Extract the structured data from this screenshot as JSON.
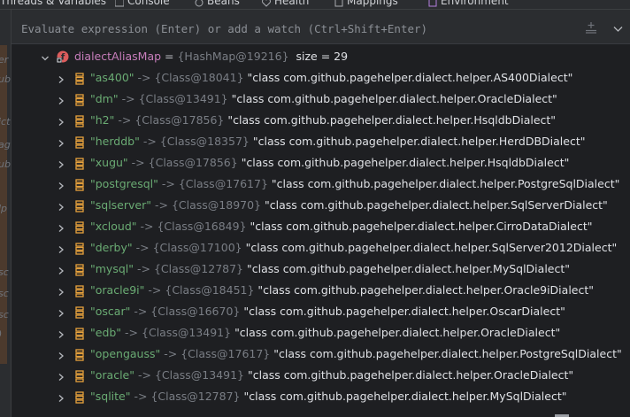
{
  "tabs": [
    {
      "label": "Threads & Variables"
    },
    {
      "label": "Console"
    },
    {
      "label": "Beans"
    },
    {
      "label": "Health"
    },
    {
      "label": "Mappings"
    },
    {
      "label": "Environment"
    }
  ],
  "left_gutter": {
    "fragments": [
      "er",
      "ub",
      "ict",
      "ag",
      "ub",
      "lp",
      "sc",
      "sc",
      "sc",
      ")"
    ]
  },
  "evaluate": {
    "placeholder": "Evaluate expression (Enter) or add a watch (Ctrl+Shift+Enter)"
  },
  "colors": {
    "key_green": "#6aab73",
    "root_name": "#c77dbb",
    "field_icon_orange": "#e8a33d",
    "root_icon_red": "#db5c5c"
  },
  "root": {
    "name": "dialectAliasMap",
    "equals": " = ",
    "ref": "{HashMap@19216}",
    "size": "size = 29",
    "expanded": true
  },
  "entries": [
    {
      "key": "\"as400\"",
      "arrow": "->",
      "ref": "{Class@18041}",
      "value": "\"class com.github.pagehelper.dialect.helper.AS400Dialect\""
    },
    {
      "key": "\"dm\"",
      "arrow": "->",
      "ref": "{Class@13491}",
      "value": "\"class com.github.pagehelper.dialect.helper.OracleDialect\""
    },
    {
      "key": "\"h2\"",
      "arrow": "->",
      "ref": "{Class@17856}",
      "value": "\"class com.github.pagehelper.dialect.helper.HsqldbDialect\""
    },
    {
      "key": "\"herddb\"",
      "arrow": "->",
      "ref": "{Class@18357}",
      "value": "\"class com.github.pagehelper.dialect.helper.HerdDBDialect\""
    },
    {
      "key": "\"xugu\"",
      "arrow": "->",
      "ref": "{Class@17856}",
      "value": "\"class com.github.pagehelper.dialect.helper.HsqldbDialect\""
    },
    {
      "key": "\"postgresql\"",
      "arrow": "->",
      "ref": "{Class@17617}",
      "value": "\"class com.github.pagehelper.dialect.helper.PostgreSqlDialect\""
    },
    {
      "key": "\"sqlserver\"",
      "arrow": "->",
      "ref": "{Class@18970}",
      "value": "\"class com.github.pagehelper.dialect.helper.SqlServerDialect\""
    },
    {
      "key": "\"xcloud\"",
      "arrow": "->",
      "ref": "{Class@16849}",
      "value": "\"class com.github.pagehelper.dialect.helper.CirroDataDialect\""
    },
    {
      "key": "\"derby\"",
      "arrow": "->",
      "ref": "{Class@17100}",
      "value": "\"class com.github.pagehelper.dialect.helper.SqlServer2012Dialect\""
    },
    {
      "key": "\"mysql\"",
      "arrow": "->",
      "ref": "{Class@12787}",
      "value": "\"class com.github.pagehelper.dialect.helper.MySqlDialect\""
    },
    {
      "key": "\"oracle9i\"",
      "arrow": "->",
      "ref": "{Class@18451}",
      "value": "\"class com.github.pagehelper.dialect.helper.Oracle9iDialect\""
    },
    {
      "key": "\"oscar\"",
      "arrow": "->",
      "ref": "{Class@16670}",
      "value": "\"class com.github.pagehelper.dialect.helper.OscarDialect\""
    },
    {
      "key": "\"edb\"",
      "arrow": "->",
      "ref": "{Class@13491}",
      "value": "\"class com.github.pagehelper.dialect.helper.OracleDialect\""
    },
    {
      "key": "\"opengauss\"",
      "arrow": "->",
      "ref": "{Class@17617}",
      "value": "\"class com.github.pagehelper.dialect.helper.PostgreSqlDialect\""
    },
    {
      "key": "\"oracle\"",
      "arrow": "->",
      "ref": "{Class@13491}",
      "value": "\"class com.github.pagehelper.dialect.helper.OracleDialect\""
    },
    {
      "key": "\"sqlite\"",
      "arrow": "->",
      "ref": "{Class@12787}",
      "value": "\"class com.github.pagehelper.dialect.helper.MySqlDialect\""
    }
  ]
}
